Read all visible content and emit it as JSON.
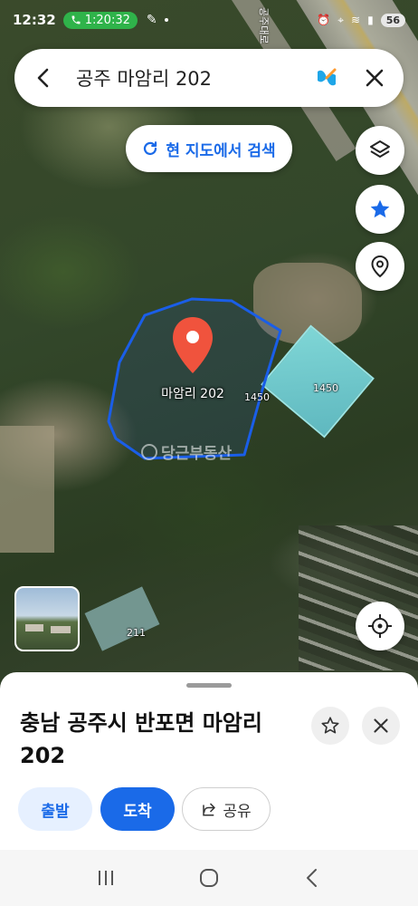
{
  "status_bar": {
    "time": "12:32",
    "call_timer": "1:20:32",
    "battery": "56"
  },
  "search": {
    "title": "공주 마암리 202"
  },
  "map": {
    "search_here_label": "현 지도에서 검색",
    "road_label": "공주대로",
    "pin_label": "마암리 202",
    "parcel_labels": [
      "1450",
      "1450",
      "211"
    ],
    "watermark": "당근부동산",
    "parcel_color": "#1a5ee8",
    "pin_color": "#f0533d"
  },
  "sheet": {
    "address": "충남 공주시 반포면 마암리 202",
    "depart_label": "출발",
    "arrive_label": "도착",
    "share_label": "공유"
  },
  "colors": {
    "accent": "#1a6ae8",
    "call_green": "#2fb34a"
  }
}
